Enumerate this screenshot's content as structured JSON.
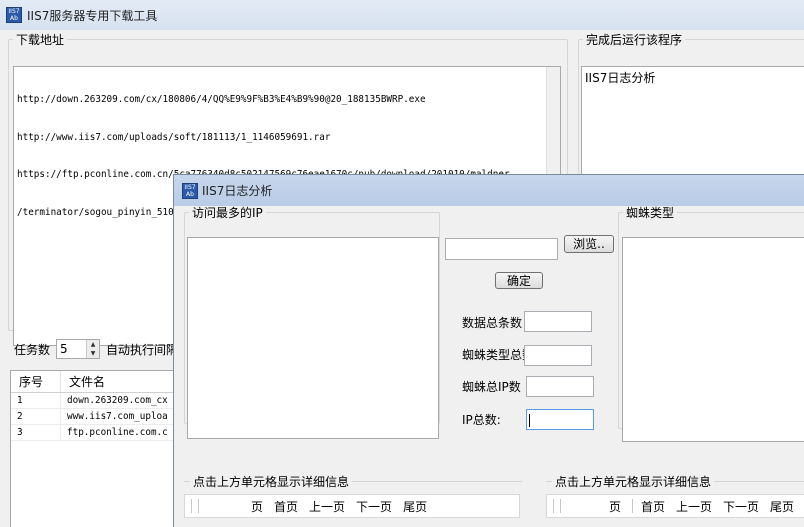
{
  "main": {
    "title": "IIS7服务器专用下载工具",
    "icon_text": [
      "IIS7",
      "Ab"
    ],
    "url_group": {
      "label": "下载地址",
      "lines": [
        "http://down.263209.com/cx/180806/4/QQ%E9%9F%B3%E4%B9%90@20_188135BWRP.exe",
        "http://www.iis7.com/uploads/soft/181113/1_1146059691.rar",
        "https://ftp.pconline.com.cn/5ca776340d8c502147569c76eae1670c/pub/download/201010/maldner",
        "/terminator/sogou_pinyin_51000003774212024980.exe"
      ]
    },
    "run_group": {
      "label": "完成后运行该程序",
      "items": [
        "IIS7日志分析"
      ]
    },
    "tasks": {
      "label": "任务数",
      "value": "5",
      "auto_label": "自动执行间隔"
    },
    "file_table": {
      "columns": [
        "序号",
        "文件名"
      ],
      "rows": [
        [
          "1",
          "down.263209.com_cx"
        ],
        [
          "2",
          "www.iis7.com_uploa"
        ],
        [
          "3",
          "ftp.pconline.com.c"
        ]
      ]
    }
  },
  "log_window": {
    "title": "IIS7日志分析",
    "ip_group_label": "访问最多的IP",
    "spider_group_label": "蜘蛛类型",
    "browse_button": "浏览..",
    "confirm_button": "确定",
    "stats": {
      "total_records": "数据总条数",
      "spider_types_total": "蜘蛛类型总数",
      "spider_ip_total": "蜘蛛总IP数",
      "ip_total": "IP总数:"
    },
    "footer_left": {
      "label": "点击上方单元格显示详细信息",
      "pager": [
        "页",
        "首页",
        "上一页",
        "下一页",
        "尾页"
      ]
    },
    "footer_right": {
      "label": "点击上方单元格显示详细信息",
      "pager": [
        "页",
        "首页",
        "上一页",
        "下一页",
        "尾页"
      ]
    }
  }
}
